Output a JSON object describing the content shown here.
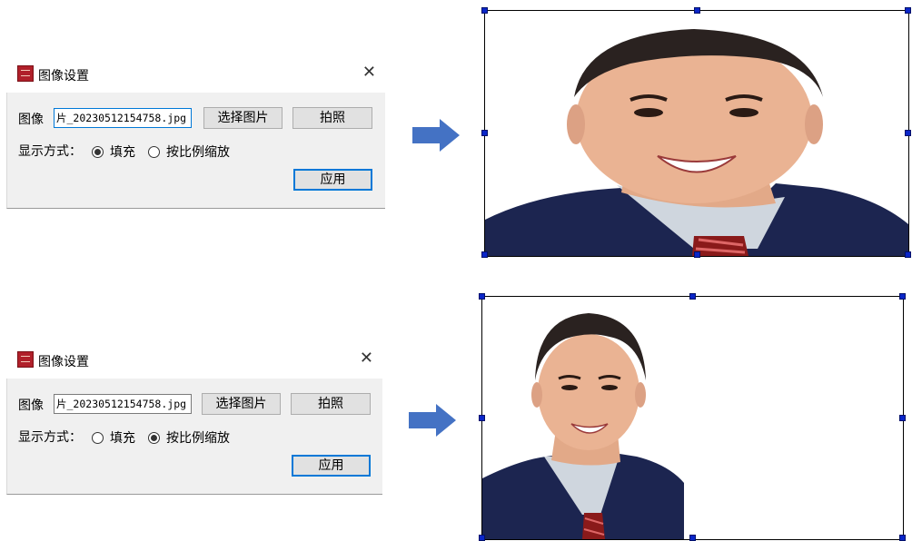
{
  "dialogs": [
    {
      "title": "图像设置",
      "close": "✕",
      "image_label": "图像",
      "file_value": "片_20230512154758.jpg",
      "choose_button": "选择图片",
      "photo_button": "拍照",
      "display_label": "显示方式：",
      "option_fill": "填充",
      "option_scale": "按比例缩放",
      "selected": "填充",
      "apply_button": "应用"
    },
    {
      "title": "图像设置",
      "close": "✕",
      "image_label": "图像",
      "file_value": "片_20230512154758.jpg",
      "choose_button": "选择图片",
      "photo_button": "拍照",
      "display_label": "显示方式：",
      "option_fill": "填充",
      "option_scale": "按比例缩放",
      "selected": "按比例缩放",
      "apply_button": "应用"
    }
  ],
  "colors": {
    "arrow": "#4472c4",
    "handle": "#0a26c8",
    "focus": "#0078d7",
    "dialog_body": "#f0f0f0"
  },
  "icons": [
    "app-icon",
    "close-icon",
    "right-arrow-icon",
    "resize-handle-icon"
  ]
}
